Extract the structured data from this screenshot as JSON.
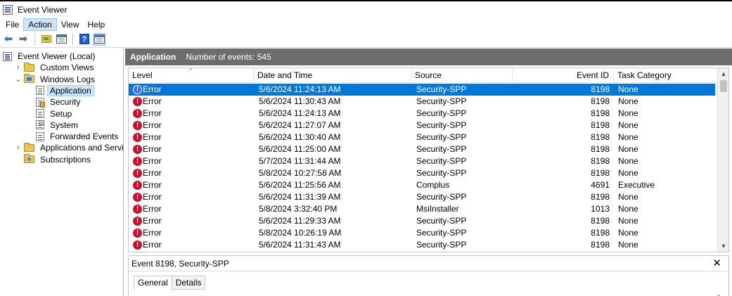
{
  "window": {
    "title": "Event Viewer"
  },
  "menu": [
    {
      "label": "File",
      "active": false
    },
    {
      "label": "Action",
      "active": true
    },
    {
      "label": "View",
      "active": false
    },
    {
      "label": "Help",
      "active": false
    }
  ],
  "toolbar": [
    {
      "name": "back-icon",
      "glyph": "arrow-left"
    },
    {
      "name": "forward-icon",
      "glyph": "arrow-right"
    },
    {
      "name": "up-folder-icon",
      "glyph": "folder"
    },
    {
      "name": "show-hide-console-tree-icon",
      "glyph": "window"
    },
    {
      "name": "help-icon",
      "glyph": "help"
    },
    {
      "name": "show-hide-action-pane-icon",
      "glyph": "window"
    }
  ],
  "tree": [
    {
      "label": "Event Viewer (Local)",
      "indent": 0,
      "toggle": "",
      "icon": "ev",
      "selected": false
    },
    {
      "label": "Custom Views",
      "indent": 1,
      "toggle": "expand",
      "icon": "folder",
      "selected": false
    },
    {
      "label": "Windows Logs",
      "indent": 1,
      "toggle": "collapse",
      "icon": "folder-win",
      "selected": false
    },
    {
      "label": "Application",
      "indent": 2,
      "toggle": "",
      "icon": "log",
      "selected": true
    },
    {
      "label": "Security",
      "indent": 2,
      "toggle": "",
      "icon": "log-sec",
      "selected": false
    },
    {
      "label": "Setup",
      "indent": 2,
      "toggle": "",
      "icon": "log",
      "selected": false
    },
    {
      "label": "System",
      "indent": 2,
      "toggle": "",
      "icon": "log-sys",
      "selected": false
    },
    {
      "label": "Forwarded Events",
      "indent": 2,
      "toggle": "",
      "icon": "log",
      "selected": false
    },
    {
      "label": "Applications and Services Lo",
      "indent": 1,
      "toggle": "expand",
      "icon": "folder",
      "selected": false
    },
    {
      "label": "Subscriptions",
      "indent": 1,
      "toggle": "",
      "icon": "folder-subs",
      "selected": false
    }
  ],
  "log": {
    "name": "Application",
    "count_text": "Number of events: 545"
  },
  "columns": [
    {
      "key": "level",
      "label": "Level"
    },
    {
      "key": "datetime",
      "label": "Date and Time"
    },
    {
      "key": "source",
      "label": "Source"
    },
    {
      "key": "event_id",
      "label": "Event ID"
    },
    {
      "key": "category",
      "label": "Task Category"
    }
  ],
  "events": [
    {
      "level": "Error",
      "datetime": "5/6/2024 11:24:13 AM",
      "source": "Security-SPP",
      "event_id": "8198",
      "category": "None",
      "selected": true
    },
    {
      "level": "Error",
      "datetime": "5/6/2024 11:30:43 AM",
      "source": "Security-SPP",
      "event_id": "8198",
      "category": "None",
      "selected": false
    },
    {
      "level": "Error",
      "datetime": "5/6/2024 11:24:13 AM",
      "source": "Security-SPP",
      "event_id": "8198",
      "category": "None",
      "selected": false
    },
    {
      "level": "Error",
      "datetime": "5/6/2024 11:27:07 AM",
      "source": "Security-SPP",
      "event_id": "8198",
      "category": "None",
      "selected": false
    },
    {
      "level": "Error",
      "datetime": "5/6/2024 11:30:40 AM",
      "source": "Security-SPP",
      "event_id": "8198",
      "category": "None",
      "selected": false
    },
    {
      "level": "Error",
      "datetime": "5/6/2024 11:25:00 AM",
      "source": "Security-SPP",
      "event_id": "8198",
      "category": "None",
      "selected": false
    },
    {
      "level": "Error",
      "datetime": "5/7/2024 11:31:44 AM",
      "source": "Security-SPP",
      "event_id": "8198",
      "category": "None",
      "selected": false
    },
    {
      "level": "Error",
      "datetime": "5/8/2024 10:27:58 AM",
      "source": "Security-SPP",
      "event_id": "8198",
      "category": "None",
      "selected": false
    },
    {
      "level": "Error",
      "datetime": "5/6/2024 11:25:56 AM",
      "source": "Complus",
      "event_id": "4691",
      "category": "Executive",
      "selected": false
    },
    {
      "level": "Error",
      "datetime": "5/6/2024 11:31:39 AM",
      "source": "Security-SPP",
      "event_id": "8198",
      "category": "None",
      "selected": false
    },
    {
      "level": "Error",
      "datetime": "5/8/2024 3:32:40 PM",
      "source": "MsiInstaller",
      "event_id": "1013",
      "category": "None",
      "selected": false
    },
    {
      "level": "Error",
      "datetime": "5/6/2024 11:29:33 AM",
      "source": "Security-SPP",
      "event_id": "8198",
      "category": "None",
      "selected": false
    },
    {
      "level": "Error",
      "datetime": "5/8/2024 10:26:19 AM",
      "source": "Security-SPP",
      "event_id": "8198",
      "category": "None",
      "selected": false
    },
    {
      "level": "Error",
      "datetime": "5/6/2024 11:31:43 AM",
      "source": "Security-SPP",
      "event_id": "8198",
      "category": "None",
      "selected": false
    }
  ],
  "detail": {
    "title": "Event 8198, Security-SPP",
    "tabs": [
      {
        "label": "General",
        "active": true
      },
      {
        "label": "Details",
        "active": false
      }
    ]
  },
  "colors": {
    "selection": "#0078d7",
    "header_bar": "#6d6d6d",
    "error_icon": "#c8102e",
    "tree_selection": "#cce4f7"
  }
}
